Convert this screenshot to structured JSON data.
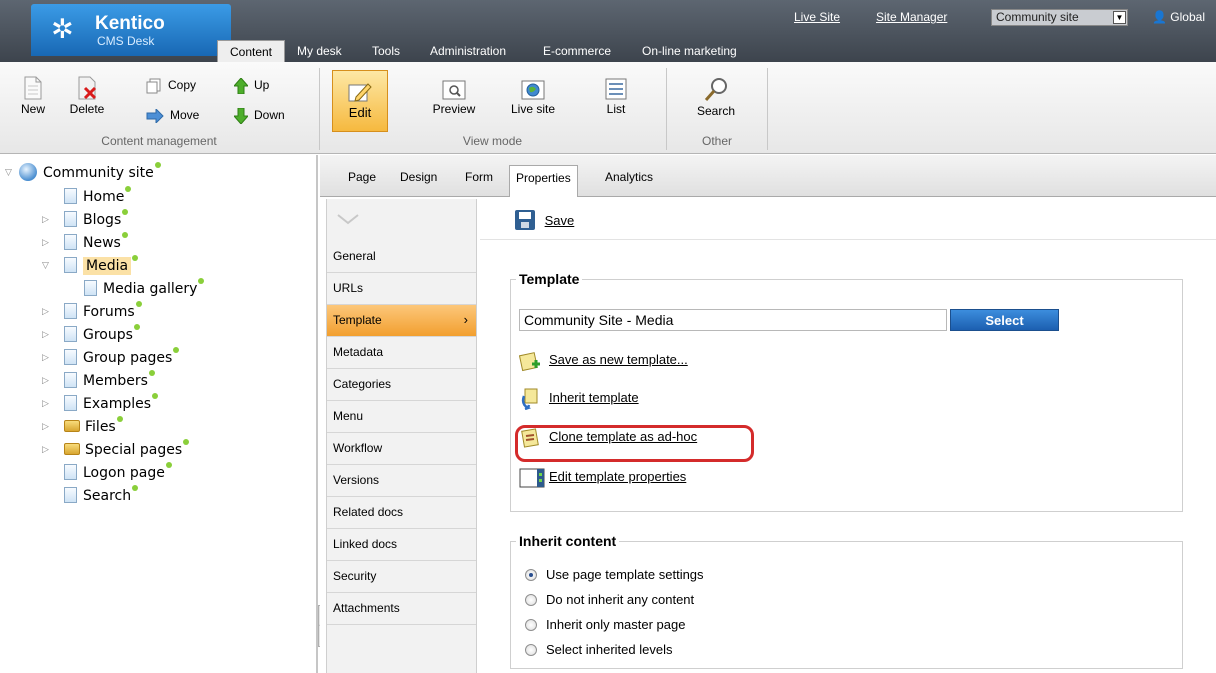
{
  "header": {
    "logo_name": "Kentico",
    "logo_sub": "CMS Desk",
    "tabs": [
      "Content",
      "My desk",
      "Tools",
      "Administration",
      "E-commerce",
      "On-line marketing"
    ],
    "active_tab": "Content",
    "links": {
      "live_site": "Live Site",
      "site_manager": "Site Manager"
    },
    "site_selector": "Community site",
    "user": "Global"
  },
  "ribbon": {
    "content_management": {
      "title": "Content management",
      "new": "New",
      "delete": "Delete",
      "copy": "Copy",
      "move": "Move",
      "up": "Up",
      "down": "Down"
    },
    "view_mode": {
      "title": "View mode",
      "edit": "Edit",
      "preview": "Preview",
      "live_site": "Live site",
      "list": "List"
    },
    "other": {
      "title": "Other",
      "search": "Search"
    }
  },
  "tree": {
    "root": "Community site",
    "items": [
      {
        "label": "Home"
      },
      {
        "label": "Blogs"
      },
      {
        "label": "News"
      },
      {
        "label": "Media"
      },
      {
        "label": "Media gallery"
      },
      {
        "label": "Forums"
      },
      {
        "label": "Groups"
      },
      {
        "label": "Group pages"
      },
      {
        "label": "Members"
      },
      {
        "label": "Examples"
      },
      {
        "label": "Files"
      },
      {
        "label": "Special pages"
      },
      {
        "label": "Logon page"
      },
      {
        "label": "Search"
      }
    ]
  },
  "content_tabs": [
    "Page",
    "Design",
    "Form",
    "Properties",
    "Analytics"
  ],
  "active_content_tab": "Properties",
  "properties_menu": [
    "General",
    "URLs",
    "Template",
    "Metadata",
    "Categories",
    "Menu",
    "Workflow",
    "Versions",
    "Related docs",
    "Linked docs",
    "Security",
    "Attachments"
  ],
  "active_properties_item": "Template",
  "form": {
    "save": "Save",
    "template": {
      "legend": "Template",
      "value": "Community Site - Media",
      "select_button": "Select",
      "actions": [
        "Save as new template...",
        "Inherit template",
        "Clone template as ad-hoc",
        "Edit template properties"
      ]
    },
    "inherit": {
      "legend": "Inherit content",
      "options": [
        "Use page template settings",
        "Do not inherit any content",
        "Inherit only master page",
        "Select inherited levels"
      ],
      "selected_index": 0
    }
  }
}
